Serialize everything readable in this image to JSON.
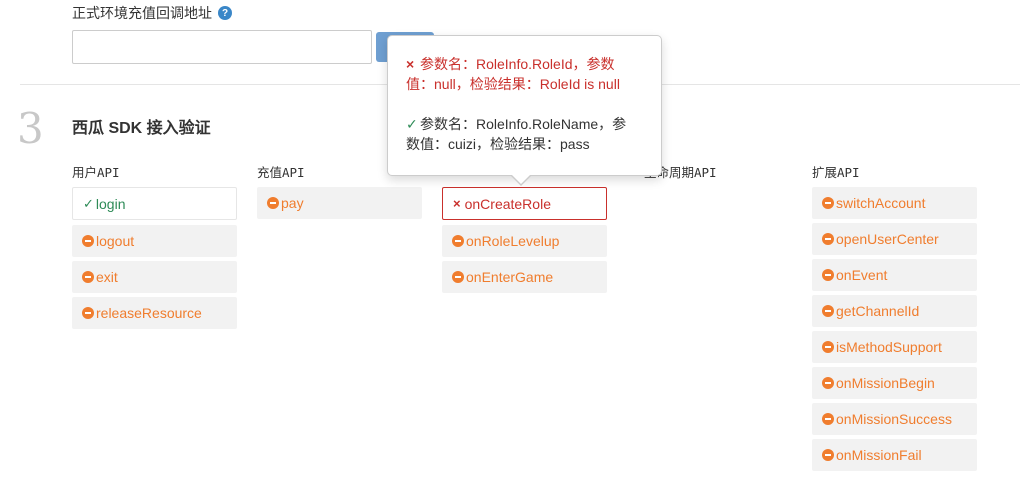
{
  "callback": {
    "label": "正式环境充值回调地址",
    "help_icon": "?",
    "input_value": "",
    "input_placeholder": "",
    "button_label": ""
  },
  "section": {
    "number": "3",
    "title": "西瓜 SDK 接入验证"
  },
  "columns": {
    "user_api": {
      "title": "用户API",
      "items": [
        {
          "label": "login",
          "status": "success"
        },
        {
          "label": "logout",
          "status": "pending"
        },
        {
          "label": "exit",
          "status": "pending"
        },
        {
          "label": "releaseResource",
          "status": "pending"
        }
      ]
    },
    "pay_api": {
      "title": "充值API",
      "items": [
        {
          "label": "pay",
          "status": "pending"
        }
      ]
    },
    "role_api": {
      "title": "",
      "items": [
        {
          "label": "onCreateRole",
          "status": "error"
        },
        {
          "label": "onRoleLevelup",
          "status": "pending"
        },
        {
          "label": "onEnterGame",
          "status": "pending"
        }
      ]
    },
    "lifecycle_api": {
      "title": "生命周期API",
      "items": []
    },
    "ext_api": {
      "title": "扩展API",
      "items": [
        {
          "label": "switchAccount",
          "status": "pending"
        },
        {
          "label": "openUserCenter",
          "status": "pending"
        },
        {
          "label": "onEvent",
          "status": "pending"
        },
        {
          "label": "getChannelId",
          "status": "pending"
        },
        {
          "label": "isMethodSupport",
          "status": "pending"
        },
        {
          "label": "onMissionBegin",
          "status": "pending"
        },
        {
          "label": "onMissionSuccess",
          "status": "pending"
        },
        {
          "label": "onMissionFail",
          "status": "pending"
        }
      ]
    }
  },
  "popover": {
    "error_mark": "×",
    "error_text": "参数名：RoleInfo.RoleId，参数值：null，检验结果：RoleId is null",
    "ok_mark": "✓",
    "ok_text": "参数名：RoleInfo.RoleName，参数值：cuizi，检验结果：pass"
  },
  "colors": {
    "pending": "#f07d2e",
    "success": "#2e8b57",
    "error": "#c9302c",
    "primary_button": "#6f9fd1"
  }
}
